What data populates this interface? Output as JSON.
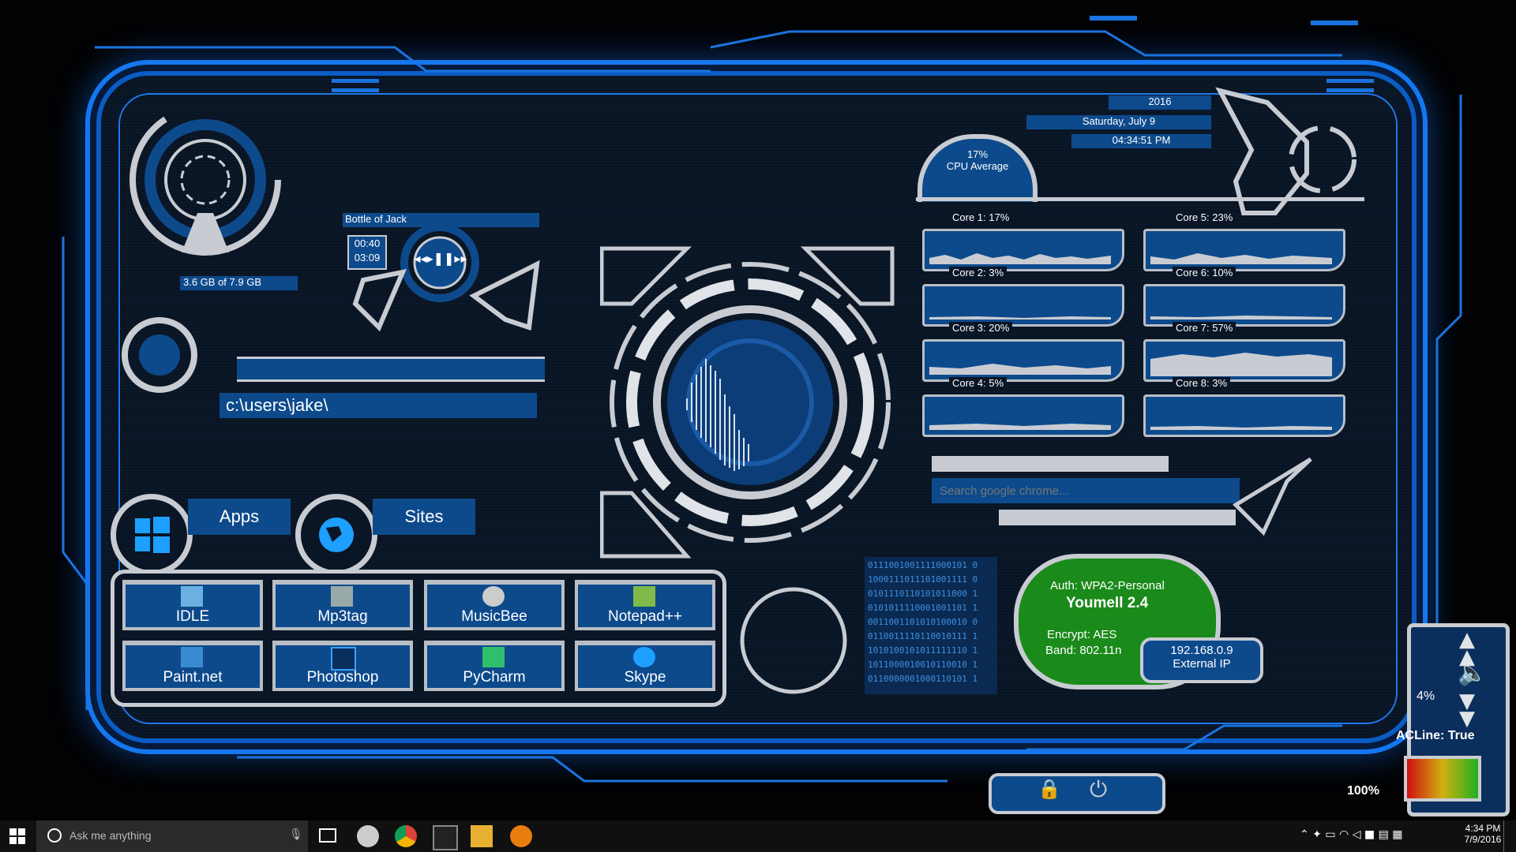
{
  "memory": {
    "label": "3.6 GB of 7.9 GB"
  },
  "player": {
    "track": "Bottle of Jack",
    "elapsed": "00:40",
    "total": "03:09"
  },
  "console": {
    "path": "c:\\users\\jake\\"
  },
  "launchers": {
    "apps_label": "Apps",
    "sites_label": "Sites"
  },
  "apps": [
    {
      "label": "IDLE",
      "icon": "idle-icon"
    },
    {
      "label": "Mp3tag",
      "icon": "mp3tag-icon"
    },
    {
      "label": "MusicBee",
      "icon": "musicbee-icon"
    },
    {
      "label": "Notepad++",
      "icon": "notepadpp-icon"
    },
    {
      "label": "Paint.net",
      "icon": "paintnet-icon"
    },
    {
      "label": "Photoshop",
      "icon": "photoshop-icon"
    },
    {
      "label": "PyCharm",
      "icon": "pycharm-icon"
    },
    {
      "label": "Skype",
      "icon": "skype-icon"
    }
  ],
  "clock": {
    "year": "2016",
    "date": "Saturday, July 9",
    "time": "04:34:51 PM"
  },
  "cpu": {
    "average": "17%",
    "average_label": "CPU Average",
    "cores": [
      {
        "label": "Core 1: 17%"
      },
      {
        "label": "Core 5: 23%"
      },
      {
        "label": "Core 2: 3%"
      },
      {
        "label": "Core 6: 10%"
      },
      {
        "label": "Core 3: 20%"
      },
      {
        "label": "Core 7: 57%"
      },
      {
        "label": "Core 4: 5%"
      },
      {
        "label": "Core 8: 3%"
      }
    ]
  },
  "search": {
    "placeholder": "Search google chrome..."
  },
  "binary": {
    "lines": [
      "0111001001111000101 0",
      "1000111011101001111 0",
      "0101110110101011000 1",
      "0101011110001001101 1",
      "0011001101010100010 0",
      "0110011110110010111 1",
      "1010100101011111110 1",
      "1011000010010110010 1",
      "0110000001000110101 1"
    ]
  },
  "network": {
    "auth": "Auth: WPA2-Personal",
    "ssid": "Youmell 2.4",
    "encrypt": "Encrypt: AES",
    "band": "Band: 802.11n",
    "ip": "192.168.0.9",
    "ip_label": "External IP"
  },
  "volume": {
    "level": "4%"
  },
  "battery": {
    "acline": "ACLine: True",
    "charge": "100%"
  },
  "taskbar": {
    "search_placeholder": "Ask me anything",
    "time": "4:34 PM",
    "date": "7/9/2016",
    "pinned": [
      "musicbee-icon",
      "chrome-icon",
      "terminal-icon",
      "file-explorer-icon",
      "blender-icon"
    ]
  },
  "colors": {
    "accent": "#1577f0",
    "panel": "#0d4a8c",
    "silver": "#c8ccd2",
    "wifi_green": "#1a8a1a"
  }
}
